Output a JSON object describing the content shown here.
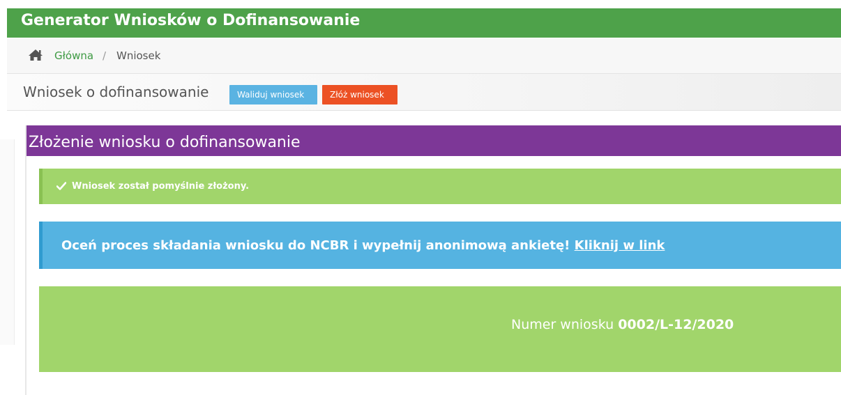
{
  "app": {
    "title": "Generator Wniosków o Dofinansowanie"
  },
  "breadcrumb": {
    "home_icon": "home-icon",
    "home": "Główna",
    "separator": "/",
    "current": "Wniosek"
  },
  "page": {
    "title": "Wniosek o dofinansowanie"
  },
  "toolbar": {
    "validate_label": "Waliduj wniosek",
    "submit_label": "Złóż wniosek"
  },
  "panel": {
    "title": "Złożenie wniosku o dofinansowanie",
    "success_icon": "check-icon",
    "success_message": "Wniosek został pomyślnie złożony.",
    "info_message": "Oceń proces składania wniosku do NCBR i wypełnij anonimową ankietę!",
    "info_link": "Kliknij w link",
    "number_label": "Numer wniosku",
    "number_value": "0002/L-12/2020"
  },
  "colors": {
    "topbar": "#4ea24a",
    "breadcrumb_link": "#3e9a43",
    "validate_button": "#5ab3e2",
    "submit_button": "#ec5124",
    "panel_header": "#7d3797",
    "success_alert": "#a1d56b",
    "info_alert": "#55b3e1"
  }
}
